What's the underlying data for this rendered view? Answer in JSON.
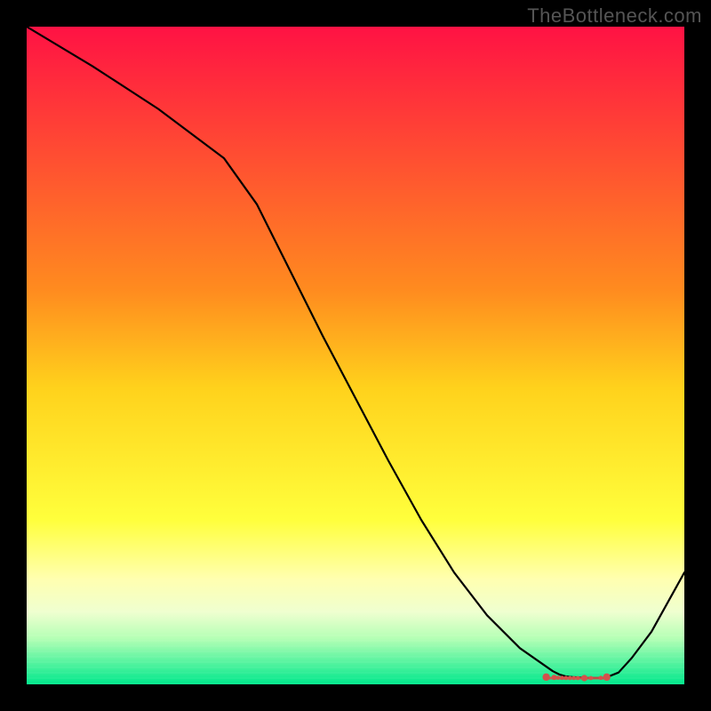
{
  "watermark": "TheBottleneck.com",
  "chart_data": {
    "type": "line",
    "title": "",
    "xlabel": "",
    "ylabel": "",
    "xlim": [
      0,
      100
    ],
    "ylim": [
      0,
      100
    ],
    "grid": false,
    "axes_visible": false,
    "background_gradient": {
      "stops": [
        {
          "offset": 0,
          "color": "#ff1244"
        },
        {
          "offset": 40,
          "color": "#ff8b1f"
        },
        {
          "offset": 55,
          "color": "#ffd21c"
        },
        {
          "offset": 75,
          "color": "#ffff3c"
        },
        {
          "offset": 84,
          "color": "#ffffb0"
        },
        {
          "offset": 89,
          "color": "#efffd0"
        },
        {
          "offset": 93,
          "color": "#b5ffb5"
        },
        {
          "offset": 100,
          "color": "#00e88c"
        }
      ]
    },
    "series": [
      {
        "name": "bottleneck-curve",
        "color": "#000000",
        "x": [
          0,
          10,
          20,
          30,
          35,
          40,
          45,
          50,
          55,
          60,
          65,
          70,
          75,
          80,
          81,
          82,
          83,
          84,
          85,
          86,
          87,
          88,
          90,
          92,
          95,
          100
        ],
        "y": [
          100,
          94,
          87.5,
          80,
          73,
          63,
          53,
          43.5,
          34,
          25,
          17,
          10.5,
          5.5,
          2,
          1.5,
          1.2,
          1.1,
          1.05,
          1,
          1,
          1,
          1,
          1.8,
          4,
          8,
          17
        ]
      }
    ],
    "markers": {
      "name": "recommended-range",
      "color": "#d4524c",
      "shape": "rounded-dot",
      "x": [
        79,
        80.2,
        80.8,
        81.4,
        82,
        82.6,
        83.2,
        83.8,
        84.8,
        85.8,
        87.3,
        88.2
      ],
      "y": [
        1.1,
        1.05,
        1.0,
        0.98,
        0.96,
        0.95,
        0.95,
        0.95,
        0.95,
        0.95,
        0.98,
        1.1
      ],
      "sizes": [
        1.4,
        1.0,
        0.8,
        0.8,
        0.8,
        0.8,
        0.8,
        0.8,
        1.2,
        0.8,
        0.8,
        1.4
      ]
    }
  }
}
